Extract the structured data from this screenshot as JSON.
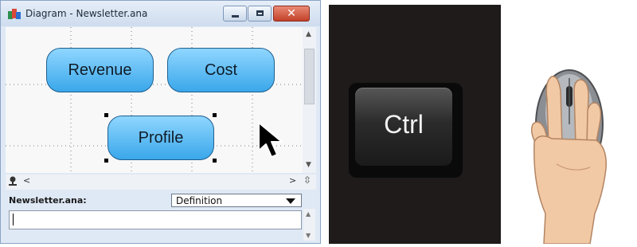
{
  "window": {
    "title": "Diagram - Newsletter.ana"
  },
  "diagram": {
    "nodes": {
      "revenue": "Revenue",
      "cost": "Cost",
      "profile": "Profile"
    }
  },
  "bottom_panel": {
    "file_label": "Newsletter.ana:",
    "view_select": "Definition"
  },
  "keyboard": {
    "key_label": "Ctrl"
  },
  "icons": {
    "app": "diagram-app-icon",
    "cursor": "arrow-cursor-icon",
    "mouse": "mouse-with-hand-icon"
  },
  "colors": {
    "node_fill": "#5bbcf5",
    "window_frame": "#dfe9f5",
    "close_button": "#c2412a",
    "key_panel": "#1e1b1a"
  }
}
